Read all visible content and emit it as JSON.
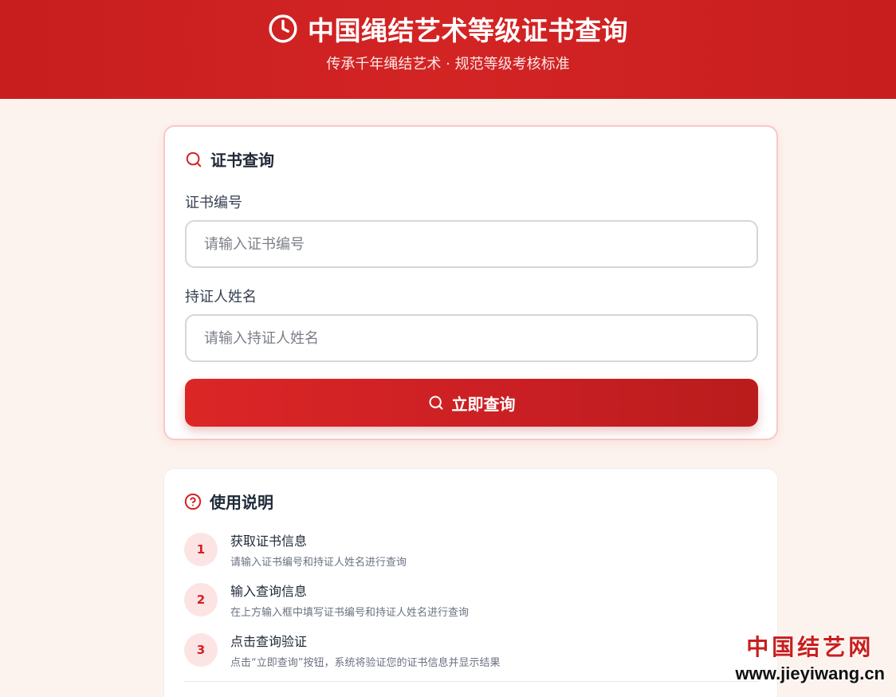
{
  "header": {
    "title": "中国绳结艺术等级证书查询",
    "subtitle": "传承千年绳结艺术 · 规范等级考核标准",
    "icon": "clock-icon"
  },
  "query": {
    "section_title": "证书查询",
    "section_icon": "search-icon",
    "cert_label": "证书编号",
    "cert_placeholder": "请输入证书编号",
    "cert_value": "",
    "name_label": "持证人姓名",
    "name_placeholder": "请输入持证人姓名",
    "name_value": "",
    "submit_label": "立即查询"
  },
  "help": {
    "section_title": "使用说明",
    "section_icon": "help-circle-icon",
    "steps": [
      {
        "num": "1",
        "title": "获取证书信息",
        "desc": "请输入证书编号和持证人姓名进行查询"
      },
      {
        "num": "2",
        "title": "输入查询信息",
        "desc": "在上方输入框中填写证书编号和持证人姓名进行查询"
      },
      {
        "num": "3",
        "title": "点击查询验证",
        "desc": "点击“立即查询”按钮，系统将验证您的证书信息并显示结果"
      }
    ]
  },
  "watermark": {
    "site_name": "中国结艺网",
    "url": "www.jieyiwang.cn"
  },
  "colors": {
    "primary": "#d32424",
    "background": "#fdf3ee",
    "step_badge_bg": "#fde4e4"
  }
}
